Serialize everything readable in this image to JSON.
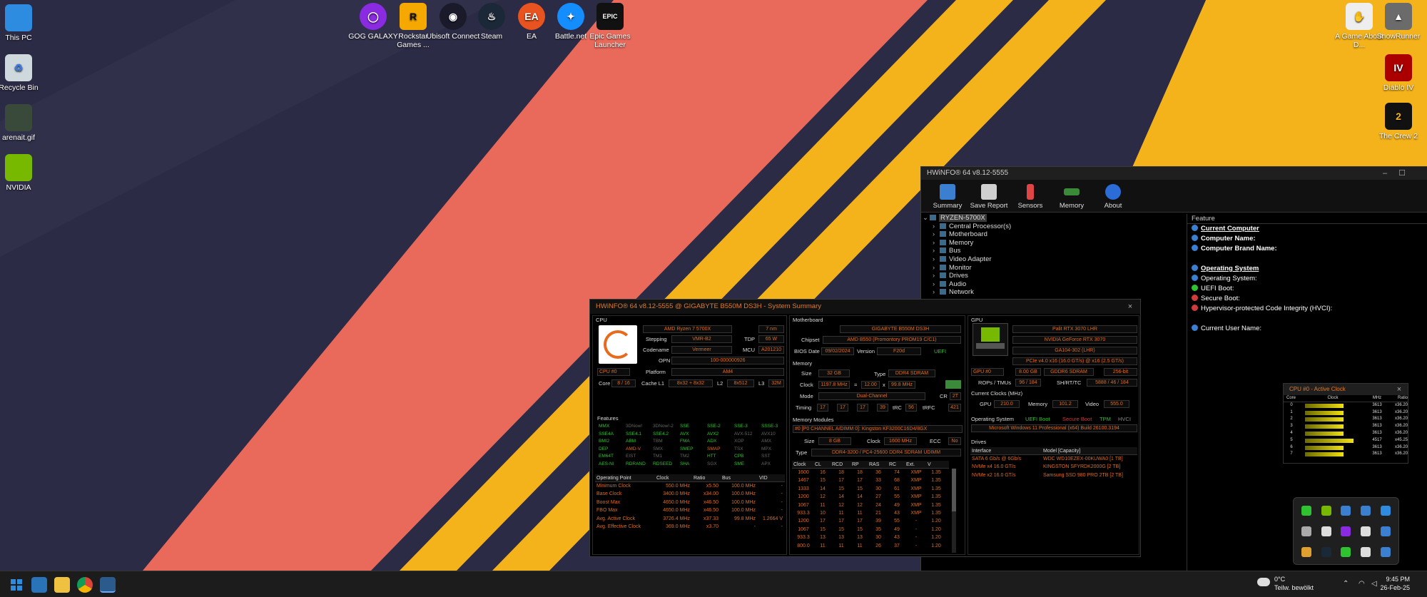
{
  "desktop": {
    "left_icons": [
      {
        "label": "This PC",
        "color": "#2d8be0"
      },
      {
        "label": "Recycle Bin",
        "color": "#cfd8dc"
      },
      {
        "label": "arenait.gif",
        "color": "#3a4a3a"
      },
      {
        "label": "NVIDIA",
        "color": "#76b900"
      }
    ],
    "top_icons": [
      {
        "label": "GOG GALAXY",
        "color": "#8a2be2",
        "glyph": "◯"
      },
      {
        "label": "Rockstar Games ...",
        "color": "#f5a800",
        "glyph": "R"
      },
      {
        "label": "Ubisoft Connect",
        "color": "#1a1a2a",
        "glyph": "◉"
      },
      {
        "label": "Steam",
        "color": "#1b2838",
        "glyph": "♨"
      },
      {
        "label": "EA",
        "color": "#e8531f",
        "glyph": "EA"
      },
      {
        "label": "Battle.net",
        "color": "#148eff",
        "glyph": "✦"
      },
      {
        "label": "Epic Games Launcher",
        "color": "#111",
        "glyph": "EPIC"
      }
    ],
    "right_icons": [
      {
        "label": "A Game About D...",
        "color": "#eeeeee",
        "glyph": "✋"
      },
      {
        "label": "SnowRunner",
        "color": "#6b6b6b",
        "glyph": "▲"
      },
      {
        "label": "Diablo IV",
        "color": "#a00",
        "glyph": "IV"
      },
      {
        "label": "The Crew 2",
        "color": "#111",
        "glyph": "2"
      }
    ]
  },
  "main_window": {
    "title": "HWiNFO® 64 v8.12-5555",
    "toolbar": [
      {
        "label": "Summary",
        "color": "#3b7fd1"
      },
      {
        "label": "Save Report",
        "color": "#cfcfcf"
      },
      {
        "label": "Sensors",
        "color": "#e04545"
      },
      {
        "label": "Memory",
        "color": "#3a8a3a"
      },
      {
        "label": "About",
        "color": "#2b6cd6"
      }
    ],
    "tree_root": "RYZEN-5700X",
    "tree_items": [
      "Central Processor(s)",
      "Motherboard",
      "Memory",
      "Bus",
      "Video Adapter",
      "Monitor",
      "Drives",
      "Audio",
      "Network"
    ],
    "feature_header": "Feature",
    "features": [
      {
        "text": "Current Computer",
        "type": "h",
        "icon": "#3b7fd1"
      },
      {
        "text": "Computer Name:",
        "type": "b",
        "icon": "#3b7fd1"
      },
      {
        "text": "Computer Brand Name:",
        "type": "b",
        "icon": "#3b7fd1"
      },
      {
        "text": "",
        "type": "s",
        "icon": ""
      },
      {
        "text": "Operating System",
        "type": "h",
        "icon": "#3b7fd1"
      },
      {
        "text": "Operating System:",
        "type": "n",
        "icon": "#3b7fd1"
      },
      {
        "text": "UEFI Boot:",
        "type": "n",
        "icon": "#2fc42f"
      },
      {
        "text": "Secure Boot:",
        "type": "n",
        "icon": "#d03b3b"
      },
      {
        "text": "Hypervisor-protected Code Integrity (HVCI):",
        "type": "n",
        "icon": "#d03b3b"
      },
      {
        "text": "",
        "type": "s",
        "icon": ""
      },
      {
        "text": "Current User Name:",
        "type": "n",
        "icon": "#3b7fd1"
      }
    ]
  },
  "summary": {
    "title": "HWiNFO® 64 v8.12-5555 @ GIGABYTE B550M DS3H - System Summary",
    "cpu": {
      "section": "CPU",
      "name": "AMD Ryzen 7 5700X",
      "nm": "7 nm",
      "stepping_label": "Stepping",
      "stepping": "VMR-B2",
      "tdp_label": "TDP",
      "tdp": "65 W",
      "codename_label": "Codename",
      "codename": "Vermeer",
      "mcu_label": "MCU",
      "mcu": "A201210",
      "opn_label": "OPN",
      "opn": "100-000000926",
      "sel": "CPU #0",
      "platform_label": "Platform",
      "platform": "AM4",
      "core_label": "Core",
      "core": "8 / 16",
      "cache_label": "Cache L1",
      "cache": "8x32 + 8x32",
      "l2_label": "L2",
      "l2": "8x512",
      "l3_label": "L3",
      "l3": "32M",
      "features_label": "Features",
      "features": [
        [
          "MMX",
          "green"
        ],
        [
          "3DNow!",
          "grey"
        ],
        [
          "3DNow!-2",
          "grey"
        ],
        [
          "SSE",
          "green"
        ],
        [
          "SSE-2",
          "green"
        ],
        [
          "SSE-3",
          "green"
        ],
        [
          "SSSE-3",
          "green"
        ],
        [
          "",
          ""
        ],
        [
          "SSE4A",
          "green"
        ],
        [
          "SSE4.1",
          "green"
        ],
        [
          "SSE4.2",
          "green"
        ],
        [
          "AVX",
          "green"
        ],
        [
          "AVX2",
          "green"
        ],
        [
          "AVX-512",
          "grey"
        ],
        [
          "AVX10",
          "grey"
        ],
        [
          "",
          ""
        ],
        [
          "BMI2",
          "green"
        ],
        [
          "ABM",
          "green"
        ],
        [
          "TBM",
          "grey"
        ],
        [
          "FMA",
          "green"
        ],
        [
          "ADX",
          "green"
        ],
        [
          "XOP",
          "grey"
        ],
        [
          "AMX",
          "grey"
        ],
        [
          "",
          ""
        ],
        [
          "DEP",
          "green"
        ],
        [
          "AMD-V",
          "orange"
        ],
        [
          "SMX",
          "grey"
        ],
        [
          "SMEP",
          "green"
        ],
        [
          "SMAP",
          "orange"
        ],
        [
          "TSX",
          "grey"
        ],
        [
          "MPX",
          "grey"
        ],
        [
          "",
          ""
        ],
        [
          "EM64T",
          "green"
        ],
        [
          "EIST",
          "grey"
        ],
        [
          "TM1",
          "grey"
        ],
        [
          "TM2",
          "grey"
        ],
        [
          "HTT",
          "green"
        ],
        [
          "CPB",
          "green"
        ],
        [
          "SST",
          "grey"
        ],
        [
          "",
          ""
        ],
        [
          "AES-NI",
          "green"
        ],
        [
          "RDRAND",
          "green"
        ],
        [
          "RDSEED",
          "green"
        ],
        [
          "SHA",
          "green"
        ],
        [
          "SGX",
          "grey"
        ],
        [
          "SME",
          "green"
        ],
        [
          "APX",
          "grey"
        ],
        [
          "",
          ""
        ]
      ],
      "op_headers": [
        "Operating Point",
        "Clock",
        "Ratio",
        "Bus",
        "VID"
      ],
      "op_rows": [
        [
          "Minimum Clock",
          "550.0 MHz",
          "x5.50",
          "100.0 MHz",
          "-"
        ],
        [
          "Base Clock",
          "3400.0 MHz",
          "x34.00",
          "100.0 MHz",
          "-"
        ],
        [
          "Boost Max",
          "4650.0 MHz",
          "x46.50",
          "100.0 MHz",
          "-"
        ],
        [
          "FBO Max",
          "4650.0 MHz",
          "x46.50",
          "100.0 MHz",
          "-"
        ],
        [
          "Avg. Active Clock",
          "3726.4 MHz",
          "x37.33",
          "99.8 MHz",
          "1.2664 V"
        ],
        [
          "Avg. Effective Clock",
          "369.0 MHz",
          "x3.70",
          "-",
          "-"
        ]
      ]
    },
    "mb": {
      "section": "Motherboard",
      "name": "GIGABYTE B550M DS3H",
      "chipset_label": "Chipset",
      "chipset": "AMD B550 (Promontory PROM19 C/C1)",
      "bios_label": "BIOS Date",
      "bios": "09/02/2024",
      "version_label": "Version",
      "version": "F20d",
      "uefi": "UEFI"
    },
    "mem": {
      "section": "Memory",
      "size_label": "Size",
      "size": "32 GB",
      "type_label": "Type",
      "type": "DDR4 SDRAM",
      "clock_label": "Clock",
      "clock": "1197.8 MHz",
      "eq": "=",
      "mult": "12.00",
      "x": "x",
      "bus": "99.8 MHz",
      "mode_label": "Mode",
      "mode": "Dual-Channel",
      "cr_label": "CR",
      "cr": "2T",
      "timing_label": "Timing",
      "t1": "17",
      "t2": "17",
      "t3": "17",
      "t4": "39",
      "trc_label": "tRC",
      "trc": "56",
      "trfc_label": "tRFC",
      "trfc": "421",
      "modules_label": "Memory Modules",
      "module_sel": "#0 [P0 CHANNEL A/DIMM 0]: Kingston KF3200C16D4/8GX",
      "msize_label": "Size",
      "msize": "8 GB",
      "mclock_label": "Clock",
      "mclock": "1600 MHz",
      "ecc_label": "ECC",
      "ecc": "No",
      "mtype_label": "Type",
      "mtype": "DDR4-3200 / PC4-25600 DDR4 SDRAM UDIMM",
      "t_headers": [
        "Clock",
        "CL",
        "RCD",
        "RP",
        "RAS",
        "RC",
        "Ext.",
        "V"
      ],
      "t_rows": [
        [
          "1600",
          "16",
          "18",
          "18",
          "36",
          "74",
          "XMP",
          "1.35"
        ],
        [
          "1467",
          "15",
          "17",
          "17",
          "33",
          "68",
          "XMP",
          "1.35"
        ],
        [
          "1333",
          "14",
          "15",
          "15",
          "30",
          "61",
          "XMP",
          "1.35"
        ],
        [
          "1200",
          "12",
          "14",
          "14",
          "27",
          "55",
          "XMP",
          "1.35"
        ],
        [
          "1067",
          "11",
          "12",
          "12",
          "24",
          "49",
          "XMP",
          "1.35"
        ],
        [
          "933.3",
          "10",
          "11",
          "11",
          "21",
          "43",
          "XMP",
          "1.35"
        ],
        [
          "1200",
          "17",
          "17",
          "17",
          "39",
          "55",
          "-",
          "1.20"
        ],
        [
          "1067",
          "15",
          "15",
          "15",
          "35",
          "49",
          "-",
          "1.20"
        ],
        [
          "933.3",
          "13",
          "13",
          "13",
          "30",
          "43",
          "-",
          "1.20"
        ],
        [
          "800.0",
          "11",
          "11",
          "11",
          "26",
          "37",
          "-",
          "1.20"
        ]
      ]
    },
    "gpu": {
      "section": "GPU",
      "name": "Palit RTX 3070 LHR",
      "chip": "NVIDIA GeForce RTX 3070",
      "die": "GA104-302 (LHR)",
      "pcie": "PCIe v4.0 x16 (16.0 GT/s) @ x16 (2.5 GT/s)",
      "sel": "GPU #0",
      "vram": "8.00 GB",
      "vtype": "GDDR6 SDRAM",
      "bus": "256-bit",
      "rops_label": "ROPs / TMUs",
      "rops": "96 / 184",
      "sh_label": "SH/RT/TC",
      "sh": "5888 / 46 / 184",
      "clocks_label": "Current Clocks (MHz)",
      "gpu_label": "GPU",
      "gpu_clk": "210.0",
      "mem_label": "Memory",
      "mem_clk": "101.2",
      "video_label": "Video",
      "video_clk": "555.0"
    },
    "os": {
      "section": "Operating System",
      "uefi": "UEFI Boot",
      "secure": "Secure Boot",
      "tpm": "TPM",
      "hvci": "HVCI",
      "name": "Microsoft Windows 11 Professional (x64) Build 26100.3194"
    },
    "drives": {
      "section": "Drives",
      "headers": [
        "Interface",
        "Model [Capacity]"
      ],
      "rows": [
        [
          "SATA 6 Gb/s @ 6Gb/s",
          "WDC WD10EZEX-00KUWA0 [1 TB]"
        ],
        [
          "NVMe x4 16.0 GT/s",
          "KINGSTON SFYRDK2000G [2 TB]"
        ],
        [
          "NVMe x2 16.0 GT/s",
          "Samsung SSD 980 PRO 2TB [2 TB]"
        ]
      ]
    }
  },
  "clock_widget": {
    "title": "CPU #0 - Active Clock",
    "h_core": "Core",
    "h_clock": "Clock",
    "h_mhz": "MHz",
    "h_ratio": "Ratio",
    "rows": [
      {
        "core": "0",
        "mhz": "3613",
        "ratio": "x36.20"
      },
      {
        "core": "1",
        "mhz": "3613",
        "ratio": "x36.20"
      },
      {
        "core": "2",
        "mhz": "3613",
        "ratio": "x36.20"
      },
      {
        "core": "3",
        "mhz": "3613",
        "ratio": "x36.20"
      },
      {
        "core": "4",
        "mhz": "3613",
        "ratio": "x36.20"
      },
      {
        "core": "5",
        "mhz": "4517",
        "ratio": "x45.25"
      },
      {
        "core": "6",
        "mhz": "3613",
        "ratio": "x36.20"
      },
      {
        "core": "7",
        "mhz": "3613",
        "ratio": "x36.20"
      }
    ]
  },
  "tray_popup": [
    "#2fc42f",
    "#76b900",
    "#3b7fd1",
    "#3b7fd1",
    "#2d8be0",
    "#aaa",
    "#ddd",
    "#8a2be2",
    "#ddd",
    "#3b7fd1",
    "#e0a030",
    "#1b2838",
    "#2fc42f",
    "#ddd",
    "#3b7fd1"
  ],
  "taskbar": {
    "weather_temp": "0°C",
    "weather_desc": "Teilw. bewölkt",
    "time": "9:45 PM",
    "date": "26-Feb-25"
  }
}
